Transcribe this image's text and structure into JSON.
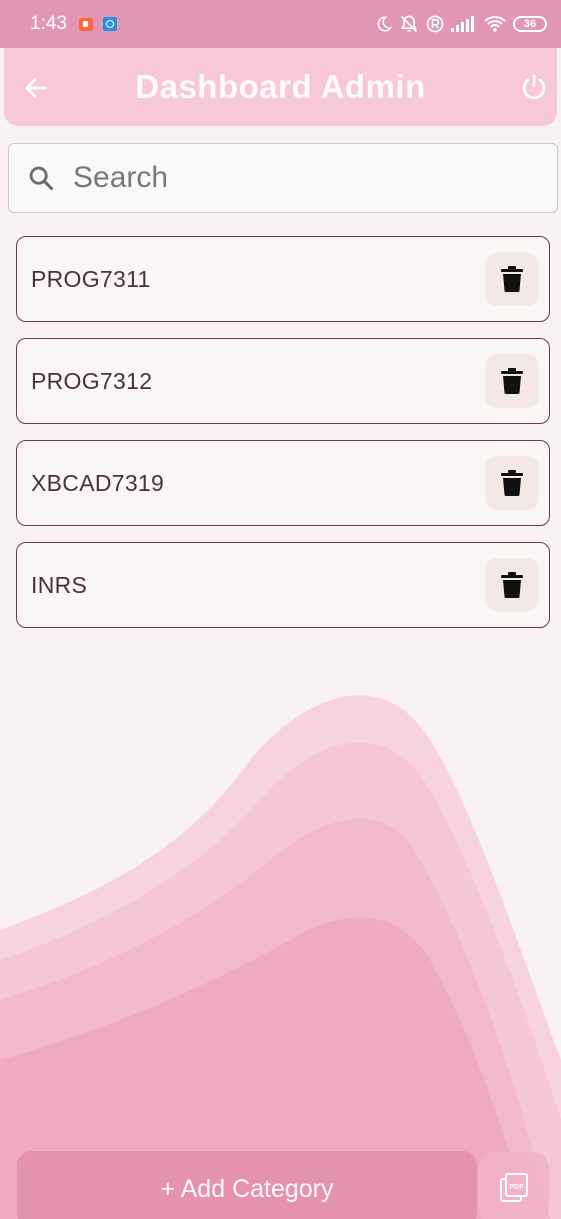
{
  "status_bar": {
    "time": "1:43",
    "battery": "36",
    "icons": [
      "recorder-app-icon",
      "app-icon",
      "moon-icon",
      "bell-off-icon",
      "registered-icon",
      "signal-icon",
      "wifi-icon",
      "battery-icon"
    ]
  },
  "app_bar": {
    "title": "Dashboard Admin",
    "back_icon": "arrow-left-icon",
    "power_icon": "power-icon"
  },
  "search": {
    "placeholder": "Search",
    "value": ""
  },
  "categories": [
    {
      "label": "PROG7311"
    },
    {
      "label": "PROG7312"
    },
    {
      "label": "XBCAD7319"
    },
    {
      "label": "INRS"
    }
  ],
  "footer": {
    "add_label": "+ Add Category",
    "pdf_label": "PDF"
  },
  "colors": {
    "status_bar": "#e196b3",
    "app_bar": "#f7c9d8",
    "item_border": "#6b3a46",
    "add_button": "#e28eac"
  }
}
